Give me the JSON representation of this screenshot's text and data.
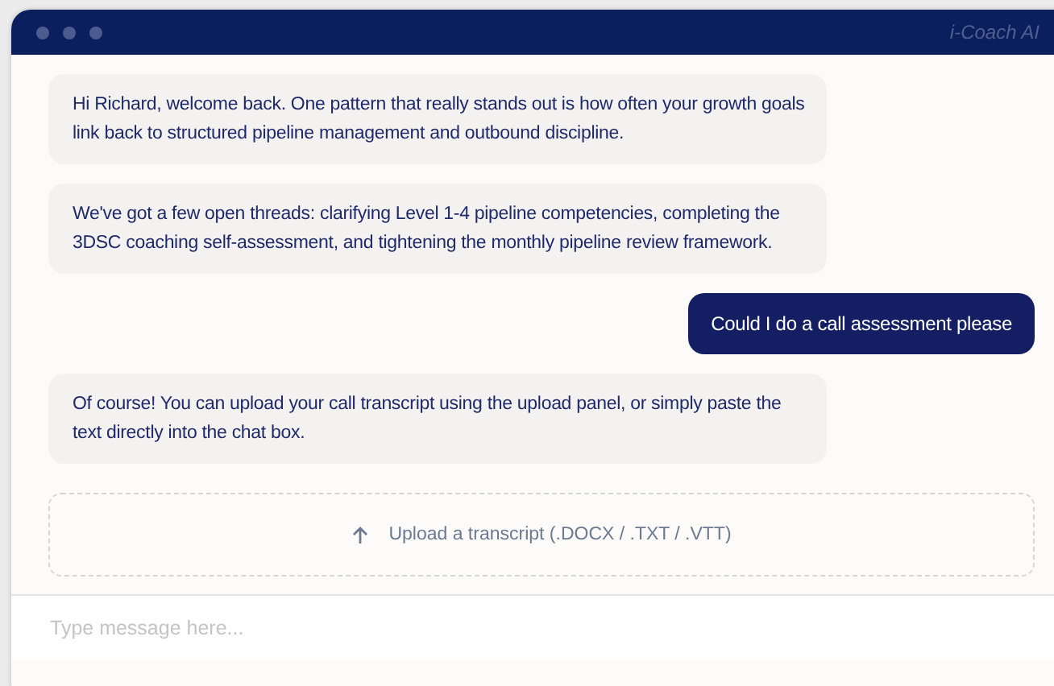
{
  "window": {
    "title": "i-Coach AI"
  },
  "messages": [
    {
      "kind": "bot",
      "text": "Hi Richard, welcome back. One pattern that really stands out is how often your growth goals link back to structured pipeline management and outbound discipline."
    },
    {
      "kind": "bot",
      "text": "We've got a few open threads: clarifying Level 1-4 pipeline competencies, completing the 3DSC coaching self-assessment, and tightening the monthly pipeline review framework."
    },
    {
      "kind": "user",
      "text": "Could I do a call assessment please"
    },
    {
      "kind": "bot",
      "text": "Of course! You can upload your call transcript using the upload panel, or simply paste the text directly into the chat box."
    }
  ],
  "upload": {
    "label": "Upload a transcript (.DOCX / .TXT / .VTT)"
  },
  "composer": {
    "placeholder": "Type message here..."
  }
}
